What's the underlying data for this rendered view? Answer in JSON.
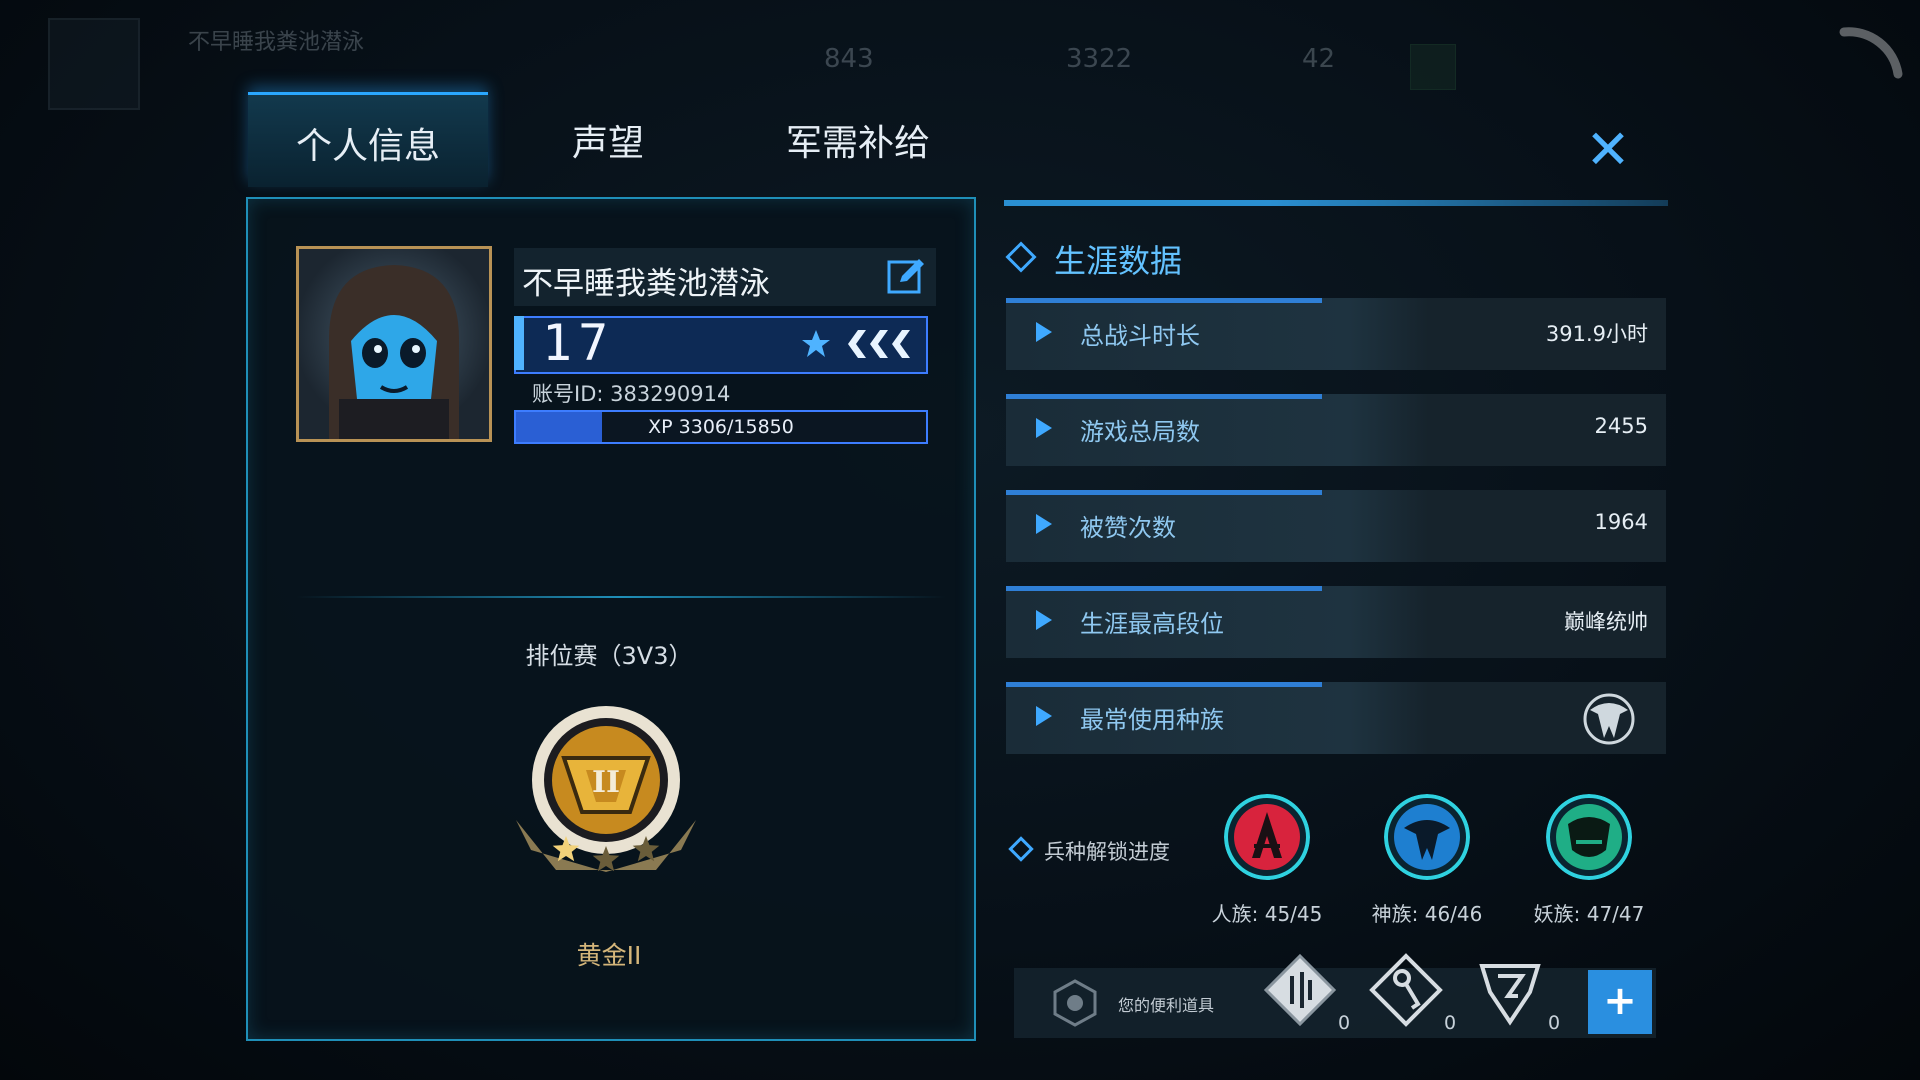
{
  "hud": {
    "player_name": "不早睡我粪池潜泳",
    "resource_1": "843",
    "resource_2": "3322",
    "resource_3": "42"
  },
  "tabs": [
    {
      "label": "个人信息",
      "active": true
    },
    {
      "label": "声望",
      "active": false
    },
    {
      "label": "军需补给",
      "active": false
    }
  ],
  "profile": {
    "name": "不早睡我粪池潜泳",
    "level": "17",
    "account_id": "账号ID: 383290914",
    "xp_text": "XP 3306/15850",
    "xp_fraction": 0.2086
  },
  "ranked": {
    "title": "排位赛（3V3）",
    "tier_numeral": "II",
    "rank_name": "黄金II",
    "stars_filled": 1,
    "stars_total": 3
  },
  "career": {
    "title": "生涯数据",
    "stats": [
      {
        "label": "总战斗时长",
        "value": "391.9小时"
      },
      {
        "label": "游戏总局数",
        "value": "2455"
      },
      {
        "label": "被赞次数",
        "value": "1964"
      },
      {
        "label": "生涯最高段位",
        "value": "巅峰统帅"
      },
      {
        "label": "最常使用种族",
        "value": ""
      }
    ]
  },
  "unlock": {
    "label": "兵种解锁进度",
    "races": [
      {
        "label": "人族: 45/45",
        "color": "#e0304a",
        "icon": "human-race-icon"
      },
      {
        "label": "神族: 46/46",
        "color": "#1f8fe0",
        "icon": "protoss-race-icon"
      },
      {
        "label": "妖族: 47/47",
        "color": "#1fb893",
        "icon": "demon-race-icon"
      }
    ]
  },
  "items": {
    "label": "您的便利道具",
    "counts": [
      "0",
      "0",
      "0"
    ]
  },
  "colors": {
    "accent": "#2aa7ff",
    "panel_border": "#1f8fb8",
    "gold": "#d5b67a"
  }
}
